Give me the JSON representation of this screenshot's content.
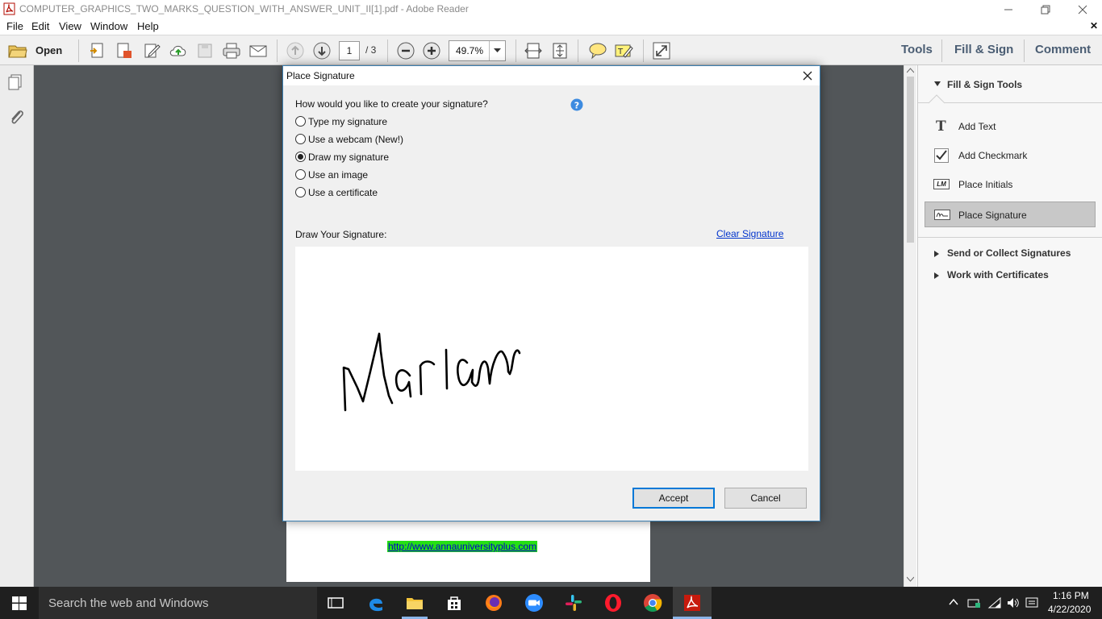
{
  "window": {
    "title": "COMPUTER_GRAPHICS_TWO_MARKS_QUESTION_WITH_ANSWER_UNIT_II[1].pdf - Adobe Reader"
  },
  "menu": [
    "File",
    "Edit",
    "View",
    "Window",
    "Help"
  ],
  "toolbar": {
    "open_label": "Open",
    "page_current": "1",
    "page_total": "/ 3",
    "zoom": "49.7%",
    "right_tabs": [
      "Tools",
      "Fill & Sign",
      "Comment"
    ]
  },
  "document": {
    "link_text": "http://www.annauniversityplus.com"
  },
  "right_panel": {
    "section_title": "Fill & Sign Tools",
    "tools": [
      "Add Text",
      "Add Checkmark",
      "Place Initials",
      "Place Signature"
    ],
    "initials_badge": "LM",
    "collapsed_sections": [
      "Send or Collect Signatures",
      "Work with Certificates"
    ]
  },
  "dialog": {
    "title": "Place Signature",
    "question": "How would you like to create your signature?",
    "options": [
      "Type my signature",
      "Use a webcam (New!)",
      "Draw my signature",
      "Use an image",
      "Use a certificate"
    ],
    "selected_option": "Draw my signature",
    "draw_label": "Draw Your Signature:",
    "clear_link": "Clear Signature",
    "accept_label": "Accept",
    "cancel_label": "Cancel"
  },
  "taskbar": {
    "search_placeholder": "Search the web and Windows",
    "time": "1:16 PM",
    "date": "4/22/2020"
  },
  "colors": {
    "accent_blue": "#0078d7",
    "link_highlight": "#25e014",
    "doc_background": "#525659"
  }
}
